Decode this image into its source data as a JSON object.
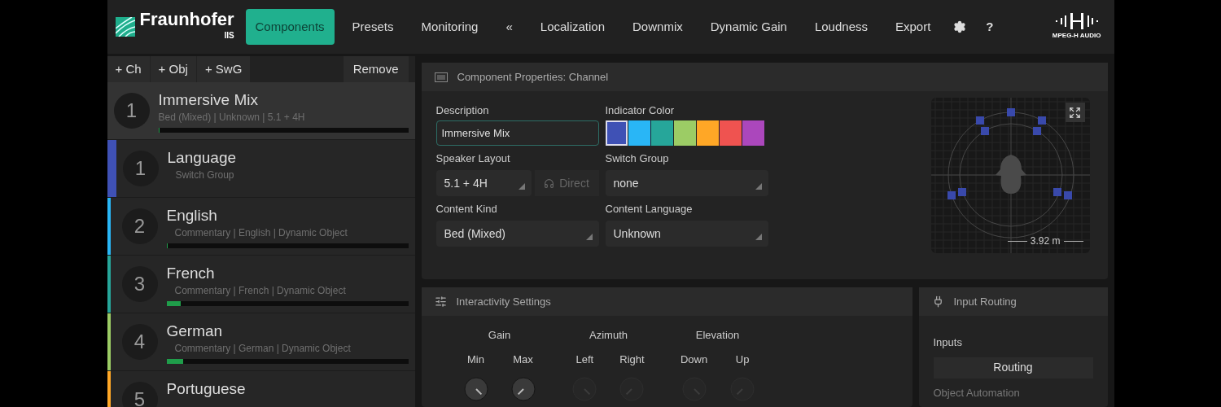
{
  "header": {
    "brand": "Fraunhofer",
    "brand_sub": "IIS",
    "nav": [
      {
        "label": "Components",
        "selected": true
      },
      {
        "label": "Presets",
        "selected": false
      },
      {
        "label": "Monitoring",
        "selected": false
      },
      {
        "label": "«",
        "selected": false
      },
      {
        "label": "Localization",
        "selected": false
      },
      {
        "label": "Downmix",
        "selected": false
      },
      {
        "label": "Dynamic Gain",
        "selected": false
      },
      {
        "label": "Loudness",
        "selected": false
      },
      {
        "label": "Export",
        "selected": false
      }
    ],
    "help": "?",
    "product_logo": "MPEG-H AUDIO"
  },
  "sidebar": {
    "add_buttons": [
      "+ Ch",
      "+ Obj",
      "+ SwG"
    ],
    "remove": "Remove",
    "components": [
      {
        "number": "1",
        "name": "Immersive Mix",
        "subtitle": "Bed (Mixed) | Unknown | 5.1 + 4H",
        "kind": "channel",
        "selected": true,
        "level": 0.005
      },
      {
        "number": "1",
        "name": "Language",
        "subtitle": "Switch Group",
        "kind": "switch_group",
        "selected": false,
        "color": "#3f51b5"
      },
      {
        "number": "2",
        "name": "English",
        "subtitle": "Commentary | English | Dynamic Object",
        "kind": "object",
        "selected": false,
        "color": "#29b6f6",
        "level": 0.005
      },
      {
        "number": "3",
        "name": "French",
        "subtitle": "Commentary | French | Dynamic Object",
        "kind": "object",
        "selected": false,
        "color": "#26a69a",
        "level": 0.06
      },
      {
        "number": "4",
        "name": "German",
        "subtitle": "Commentary | German | Dynamic Object",
        "kind": "object",
        "selected": false,
        "color": "#9ccc65",
        "level": 0.07
      },
      {
        "number": "5",
        "name": "Portuguese",
        "kind": "object",
        "selected": false,
        "color": "#ffa726"
      }
    ]
  },
  "properties": {
    "title": "Component Properties: Channel",
    "description": {
      "label": "Description",
      "value": "Immersive Mix"
    },
    "indicator_color": {
      "label": "Indicator Color",
      "swatches": [
        {
          "color": "#3f51b5",
          "selected": true
        },
        {
          "color": "#29b6f6",
          "selected": false
        },
        {
          "color": "#26a69a",
          "selected": false
        },
        {
          "color": "#9ccc65",
          "selected": false
        },
        {
          "color": "#ffa726",
          "selected": false
        },
        {
          "color": "#ef5350",
          "selected": false
        },
        {
          "color": "#ab47bc",
          "selected": false
        }
      ]
    },
    "speaker_layout": {
      "label": "Speaker Layout",
      "value": "5.1 + 4H",
      "direct": "Direct",
      "direct_disabled": true
    },
    "switch_group": {
      "label": "Switch Group",
      "value": "none"
    },
    "content_kind": {
      "label": "Content Kind",
      "value": "Bed (Mixed)"
    },
    "content_language": {
      "label": "Content Language",
      "value": "Unknown"
    },
    "radar_scale": "3.92 m"
  },
  "interactivity": {
    "title": "Interactivity Settings",
    "groups": [
      {
        "label": "Gain",
        "disabled": false,
        "knobs": [
          "Min",
          "Max"
        ]
      },
      {
        "label": "Azimuth",
        "disabled": true,
        "knobs": [
          "Left",
          "Right"
        ]
      },
      {
        "label": "Elevation",
        "disabled": true,
        "knobs": [
          "Down",
          "Up"
        ]
      }
    ]
  },
  "input_routing": {
    "title": "Input Routing",
    "inputs_label": "Inputs",
    "routing_button": "Routing",
    "automation_label": "Object Automation"
  }
}
